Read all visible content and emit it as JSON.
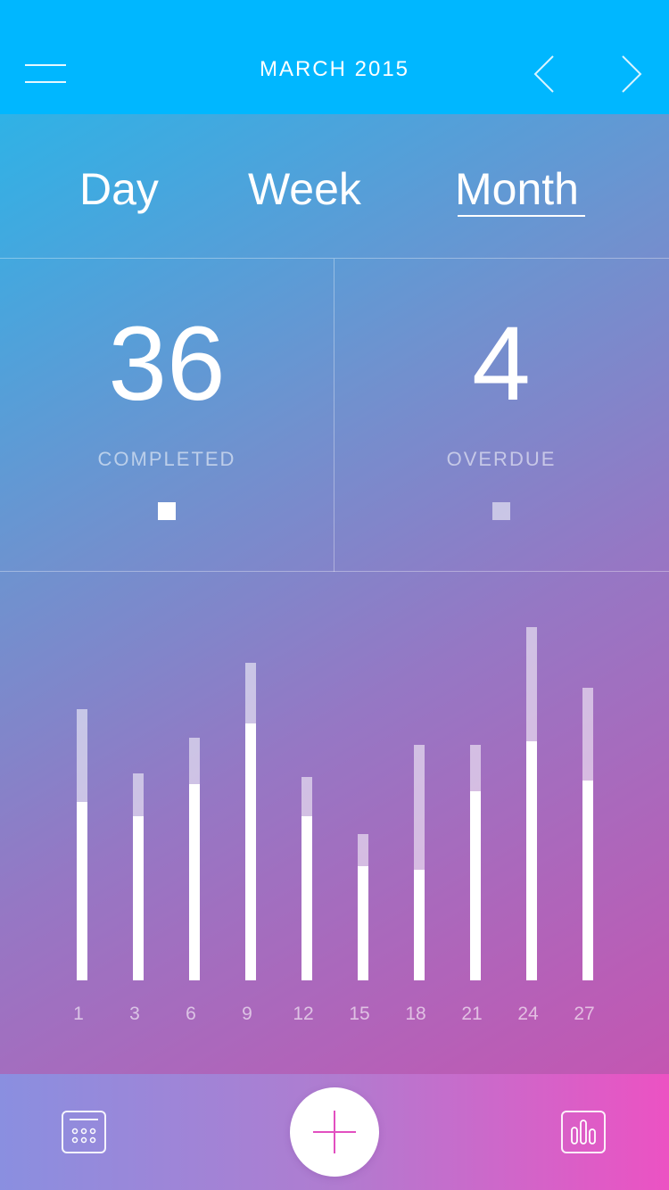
{
  "header": {
    "title": "MARCH 2015",
    "menu_icon": "hamburger-menu-icon",
    "prev_icon": "chevron-left-icon",
    "next_icon": "chevron-right-icon"
  },
  "tabs": [
    {
      "label": "Day",
      "selected": false
    },
    {
      "label": "Week",
      "selected": false
    },
    {
      "label": "Month",
      "selected": true
    }
  ],
  "stats": {
    "completed": {
      "value": "36",
      "label": "COMPLETED",
      "color": "#ffffff"
    },
    "overdue": {
      "value": "4",
      "label": "OVERDUE",
      "color": "#d4c8ec"
    }
  },
  "chart_data": {
    "type": "bar",
    "stacked": true,
    "categories": [
      "1",
      "3",
      "6",
      "9",
      "12",
      "15",
      "18",
      "21",
      "24",
      "27"
    ],
    "series": [
      {
        "name": "COMPLETED",
        "color": "#ffffff",
        "values": [
          5.0,
          4.6,
          5.5,
          7.2,
          4.6,
          3.2,
          3.1,
          5.3,
          6.7,
          5.6
        ]
      },
      {
        "name": "OVERDUE",
        "color": "rgba(255,255,255,0.6)",
        "values": [
          2.6,
          1.2,
          1.3,
          1.7,
          1.1,
          0.9,
          3.5,
          1.3,
          3.2,
          2.6
        ]
      }
    ],
    "ylim": [
      0,
      10
    ],
    "grid": false,
    "legend": "none"
  },
  "bottom_bar": {
    "calendar_icon": "calendar-icon",
    "add_icon": "plus-icon",
    "stats_icon": "bar-chart-icon"
  },
  "colors": {
    "header_bg": "#00b7ff",
    "gradient_start": "#2fb2e6",
    "gradient_end": "#c456b2",
    "accent": "#e24fc0"
  }
}
